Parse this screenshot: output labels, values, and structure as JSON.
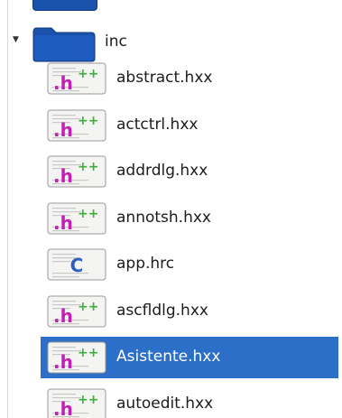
{
  "folder": {
    "label": "inc",
    "expander_icon": "expanded-triangle-icon",
    "icon": "folder-icon",
    "color": "#1a52ac"
  },
  "files": [
    {
      "label": "abstract.hxx",
      "type": "cpp-header",
      "icon_text": ".h",
      "icon_sup": "++",
      "selected": false
    },
    {
      "label": "actctrl.hxx",
      "type": "cpp-header",
      "icon_text": ".h",
      "icon_sup": "++",
      "selected": false
    },
    {
      "label": "addrdlg.hxx",
      "type": "cpp-header",
      "icon_text": ".h",
      "icon_sup": "++",
      "selected": false
    },
    {
      "label": "annotsh.hxx",
      "type": "cpp-header",
      "icon_text": ".h",
      "icon_sup": "++",
      "selected": false
    },
    {
      "label": "app.hrc",
      "type": "c-source",
      "icon_text": "C",
      "icon_sup": "",
      "selected": false
    },
    {
      "label": "ascfldlg.hxx",
      "type": "cpp-header",
      "icon_text": ".h",
      "icon_sup": "++",
      "selected": false
    },
    {
      "label": "Asistente.hxx",
      "type": "cpp-header",
      "icon_text": ".h",
      "icon_sup": "++",
      "selected": true
    },
    {
      "label": "autoedit.hxx",
      "type": "cpp-header",
      "icon_text": ".h",
      "icon_sup": "++",
      "selected": false
    }
  ],
  "colors": {
    "selection": "#2b6fc9",
    "h_magenta": "#c21fb6",
    "plus_green": "#3ab23a",
    "c_blue": "#2f5fbf"
  }
}
